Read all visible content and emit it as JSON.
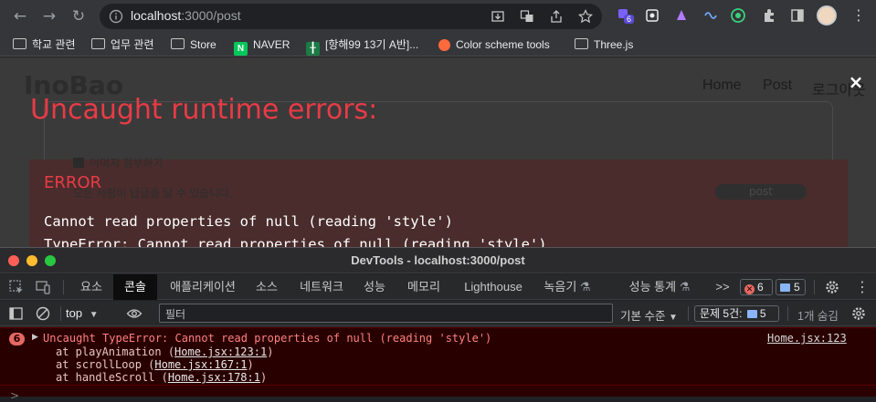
{
  "browser": {
    "url_host": "localhost",
    "url_path": ":3000/post",
    "extension_badge": "6",
    "bookmarks": [
      {
        "label": "학교 관련",
        "kind": "folder"
      },
      {
        "label": "업무 관련",
        "kind": "folder"
      },
      {
        "label": "Store",
        "kind": "folder"
      },
      {
        "label": "NAVER",
        "kind": "naver"
      },
      {
        "label": "[항해99 13기 A반]...",
        "kind": "hanghae"
      },
      {
        "label": "Color scheme tools",
        "kind": "color"
      },
      {
        "label": "Three.js",
        "kind": "folder"
      }
    ]
  },
  "page": {
    "logo": "InoBao",
    "nav": [
      "Home",
      "Post",
      "로그아웃"
    ],
    "attach_label": "이미지 첨부하기",
    "reply_hint": "모든 사람이 답글을 달 수 있습니다.",
    "post_button": "post"
  },
  "error_overlay": {
    "title": "Uncaught runtime errors:",
    "close": "×",
    "label": "ERROR",
    "message": "Cannot read properties of null (reading 'style')",
    "message2": "TypeError: Cannot read properties of null (reading 'style')"
  },
  "devtools": {
    "title": "DevTools - localhost:3000/post",
    "tabs": [
      "요소",
      "콘솔",
      "애플리케이션",
      "소스",
      "네트워크",
      "성능",
      "메모리",
      "Lighthouse",
      "녹음기",
      "성능 통계"
    ],
    "active_tab": "콘솔",
    "more": ">>",
    "error_count": "6",
    "message_count": "5",
    "context": "top",
    "filter_placeholder": "필터",
    "level": "기본 수준",
    "issues_label": "문제 5건:",
    "issues_count": "5",
    "hidden": "1개 숨김",
    "entry": {
      "count": "6",
      "message": "Uncaught TypeError: Cannot read properties of null (reading 'style')",
      "source": "Home.jsx:123",
      "stack": [
        {
          "fn": "at playAnimation (",
          "loc": "Home.jsx:123:1",
          "end": ")"
        },
        {
          "fn": "at scrollLoop (",
          "loc": "Home.jsx:167:1",
          "end": ")"
        },
        {
          "fn": "at handleScroll (",
          "loc": "Home.jsx:178:1",
          "end": ")"
        }
      ]
    },
    "prompt": ">"
  },
  "colors": {
    "error_red": "#e83b46",
    "console_error_bg": "#290000",
    "accent_blue": "#8ab4f8"
  }
}
